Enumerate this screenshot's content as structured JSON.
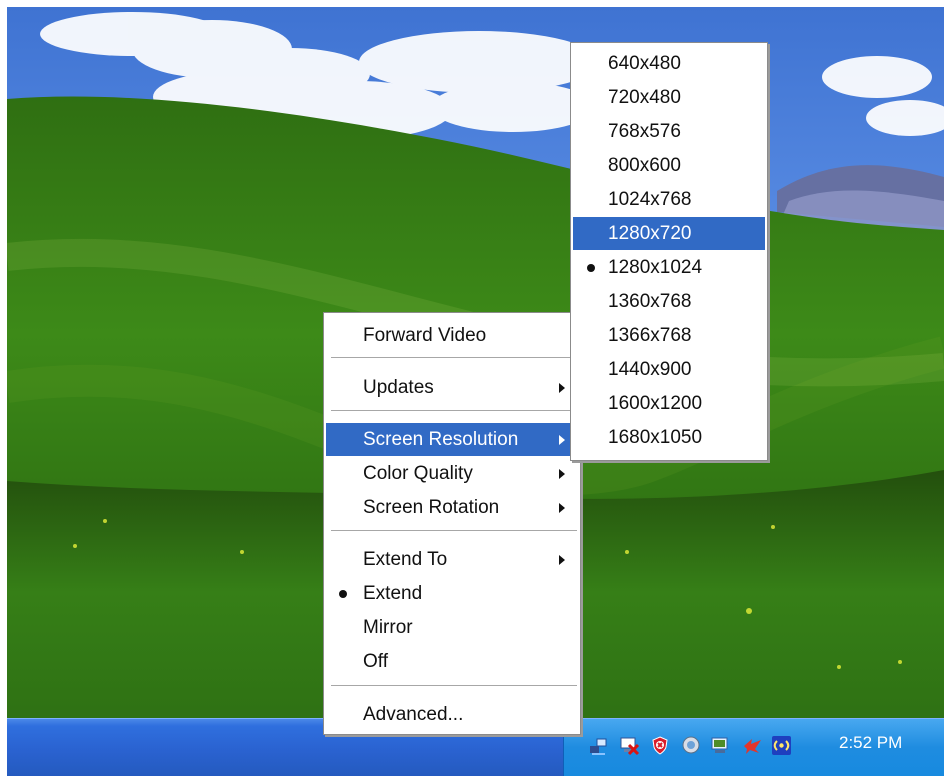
{
  "desktop": {
    "wallpaper": "Bliss-style landscape"
  },
  "context_menu": {
    "items": [
      {
        "label": "Forward Video",
        "arrow": false,
        "bullet": false,
        "selected": false
      },
      {
        "label": "Updates",
        "arrow": true,
        "bullet": false,
        "selected": false
      },
      {
        "label": "Screen Resolution",
        "arrow": true,
        "bullet": false,
        "selected": true
      },
      {
        "label": "Color Quality",
        "arrow": true,
        "bullet": false,
        "selected": false
      },
      {
        "label": "Screen Rotation",
        "arrow": true,
        "bullet": false,
        "selected": false
      },
      {
        "label": "Extend To",
        "arrow": true,
        "bullet": false,
        "selected": false
      },
      {
        "label": "Extend",
        "arrow": false,
        "bullet": true,
        "selected": false
      },
      {
        "label": "Mirror",
        "arrow": false,
        "bullet": false,
        "selected": false
      },
      {
        "label": "Off",
        "arrow": false,
        "bullet": false,
        "selected": false
      },
      {
        "label": "Advanced...",
        "arrow": false,
        "bullet": false,
        "selected": false
      }
    ]
  },
  "resolution_submenu": {
    "items": [
      {
        "label": "640x480",
        "bullet": false,
        "selected": false
      },
      {
        "label": "720x480",
        "bullet": false,
        "selected": false
      },
      {
        "label": "768x576",
        "bullet": false,
        "selected": false
      },
      {
        "label": "800x600",
        "bullet": false,
        "selected": false
      },
      {
        "label": "1024x768",
        "bullet": false,
        "selected": false
      },
      {
        "label": "1280x720",
        "bullet": false,
        "selected": true
      },
      {
        "label": "1280x1024",
        "bullet": true,
        "selected": false
      },
      {
        "label": "1360x768",
        "bullet": false,
        "selected": false
      },
      {
        "label": "1366x768",
        "bullet": false,
        "selected": false
      },
      {
        "label": "1440x900",
        "bullet": false,
        "selected": false
      },
      {
        "label": "1600x1200",
        "bullet": false,
        "selected": false
      },
      {
        "label": "1680x1050",
        "bullet": false,
        "selected": false
      }
    ]
  },
  "taskbar": {
    "clock": "2:52 PM",
    "tray_icons": [
      "network-icon",
      "display-icon",
      "security-shield-icon",
      "speaker-icon",
      "monitor-icon",
      "red-bird-icon",
      "wireless-icon"
    ]
  }
}
